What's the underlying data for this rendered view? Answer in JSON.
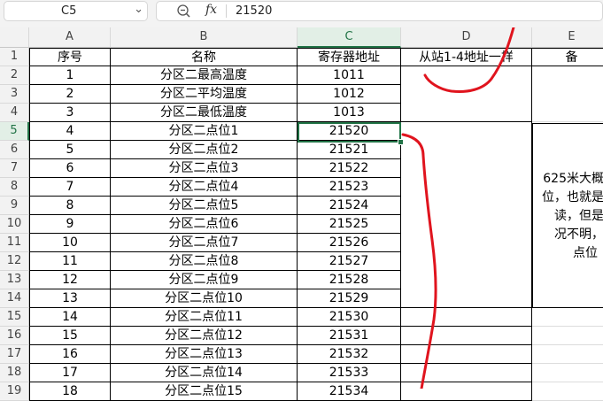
{
  "formula_bar": {
    "name_box": "C5",
    "fx_label": "fx",
    "value": "21520"
  },
  "columns": [
    "A",
    "B",
    "C",
    "D",
    "E"
  ],
  "selected_column": "C",
  "selected_row": 5,
  "header_row": {
    "a": "序号",
    "b": "名称",
    "c": "寄存器地址",
    "d": "从站1-4地址一样",
    "e": "备"
  },
  "rows": [
    {
      "n": "2",
      "a": "1",
      "b": "分区二最高温度",
      "c": "1011"
    },
    {
      "n": "3",
      "a": "2",
      "b": "分区二平均温度",
      "c": "1012"
    },
    {
      "n": "4",
      "a": "3",
      "b": "分区二最低温度",
      "c": "1013"
    },
    {
      "n": "5",
      "a": "4",
      "b": "分区二点位1",
      "c": "21520"
    },
    {
      "n": "6",
      "a": "5",
      "b": "分区二点位2",
      "c": "21521"
    },
    {
      "n": "7",
      "a": "6",
      "b": "分区二点位3",
      "c": "21522"
    },
    {
      "n": "8",
      "a": "7",
      "b": "分区二点位4",
      "c": "21523"
    },
    {
      "n": "9",
      "a": "8",
      "b": "分区二点位5",
      "c": "21524"
    },
    {
      "n": "10",
      "a": "9",
      "b": "分区二点位6",
      "c": "21525"
    },
    {
      "n": "11",
      "a": "10",
      "b": "分区二点位7",
      "c": "21526"
    },
    {
      "n": "12",
      "a": "11",
      "b": "分区二点位8",
      "c": "21527"
    },
    {
      "n": "13",
      "a": "12",
      "b": "分区二点位9",
      "c": "21528"
    },
    {
      "n": "14",
      "a": "13",
      "b": "分区二点位10",
      "c": "21529"
    },
    {
      "n": "15",
      "a": "14",
      "b": "分区二点位11",
      "c": "21530"
    },
    {
      "n": "16",
      "a": "15",
      "b": "分区二点位12",
      "c": "21531"
    },
    {
      "n": "17",
      "a": "16",
      "b": "分区二点位13",
      "c": "21532"
    },
    {
      "n": "18",
      "a": "17",
      "b": "分区二点位14",
      "c": "21533"
    },
    {
      "n": "19",
      "a": "18",
      "b": "分区二点位15",
      "c": "21534"
    }
  ],
  "note_lines": [
    "625米大概",
    "位，也就是",
    "读，但是",
    "况不明，",
    "点位"
  ],
  "colors": {
    "accent": "#217346",
    "annotation": "#e0141e"
  }
}
